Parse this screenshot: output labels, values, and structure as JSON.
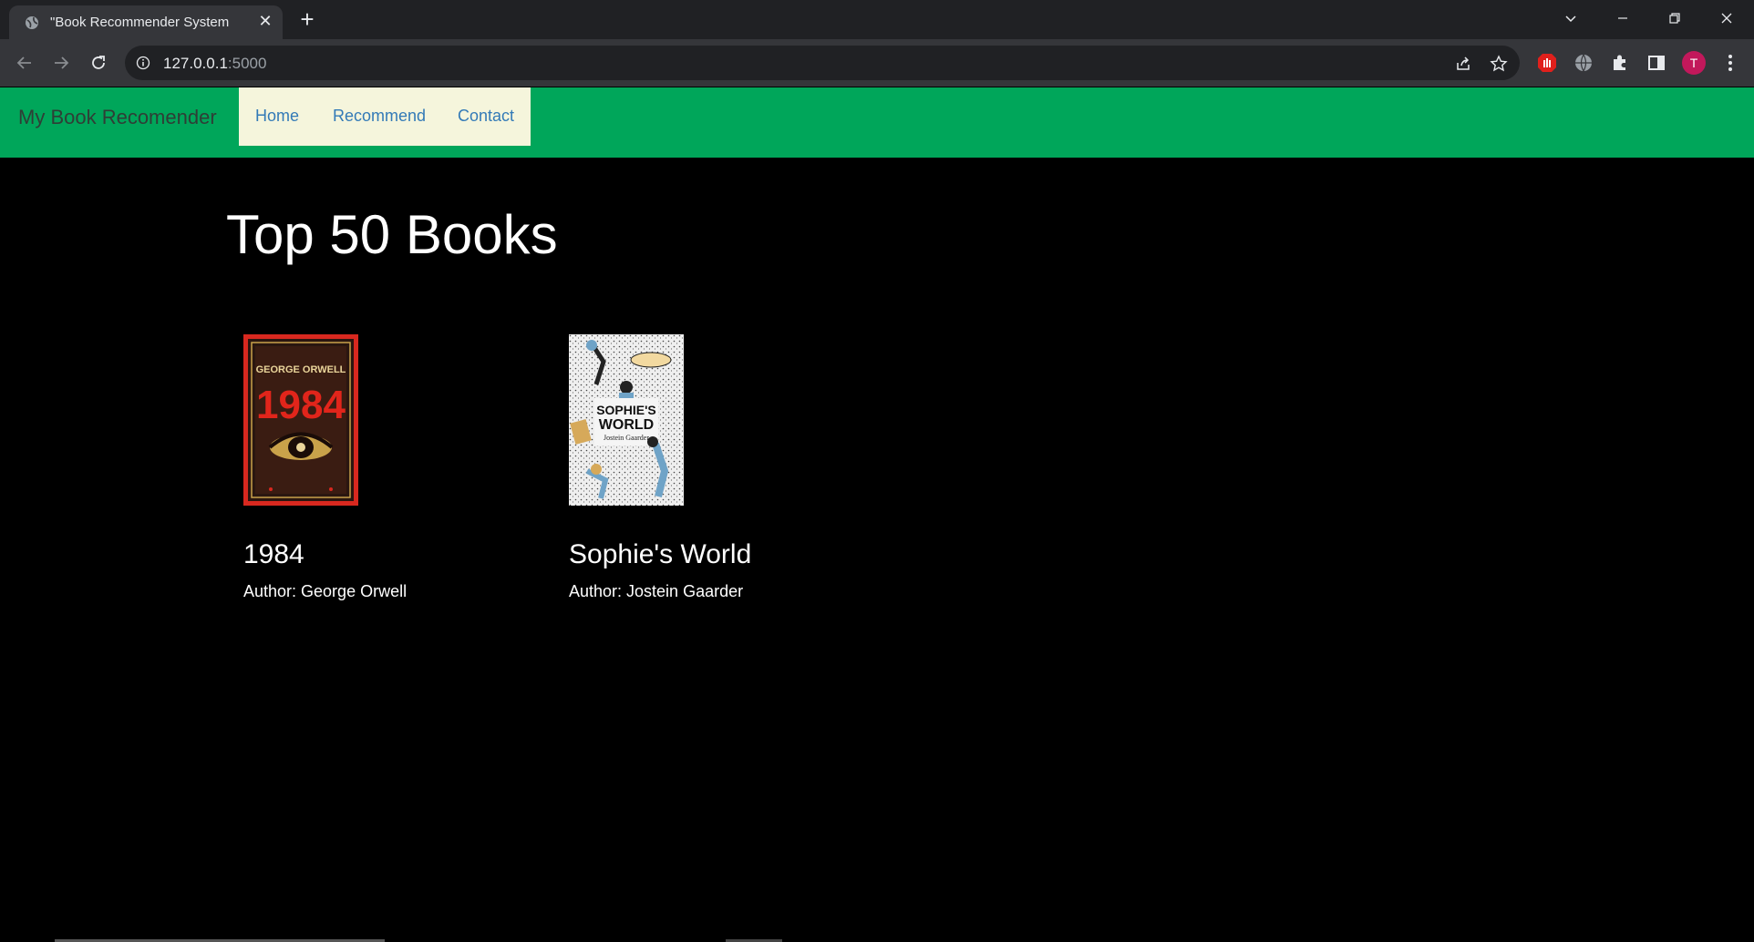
{
  "browser": {
    "tab_title": "\"Book Recommender System",
    "url_host": "127.0.0.1",
    "url_port": ":5000",
    "profile_initial": "T"
  },
  "navbar": {
    "brand": "My Book Recomender",
    "links": [
      "Home",
      "Recommend",
      "Contact"
    ],
    "bg_color": "#00a65a",
    "links_bg_color": "#f5f5dc",
    "link_color": "#337ab7"
  },
  "main": {
    "heading": "Top 50 Books",
    "books": [
      {
        "title": "1984",
        "author": "Author: George Orwell",
        "cover_text": [
          "GEORGE ORWELL",
          "1984"
        ]
      },
      {
        "title": "Sophie's World",
        "author": "Author: Jostein Gaarder",
        "cover_text": [
          "SOPHIE'S",
          "WORLD",
          "Jostein Gaarder"
        ]
      }
    ]
  }
}
